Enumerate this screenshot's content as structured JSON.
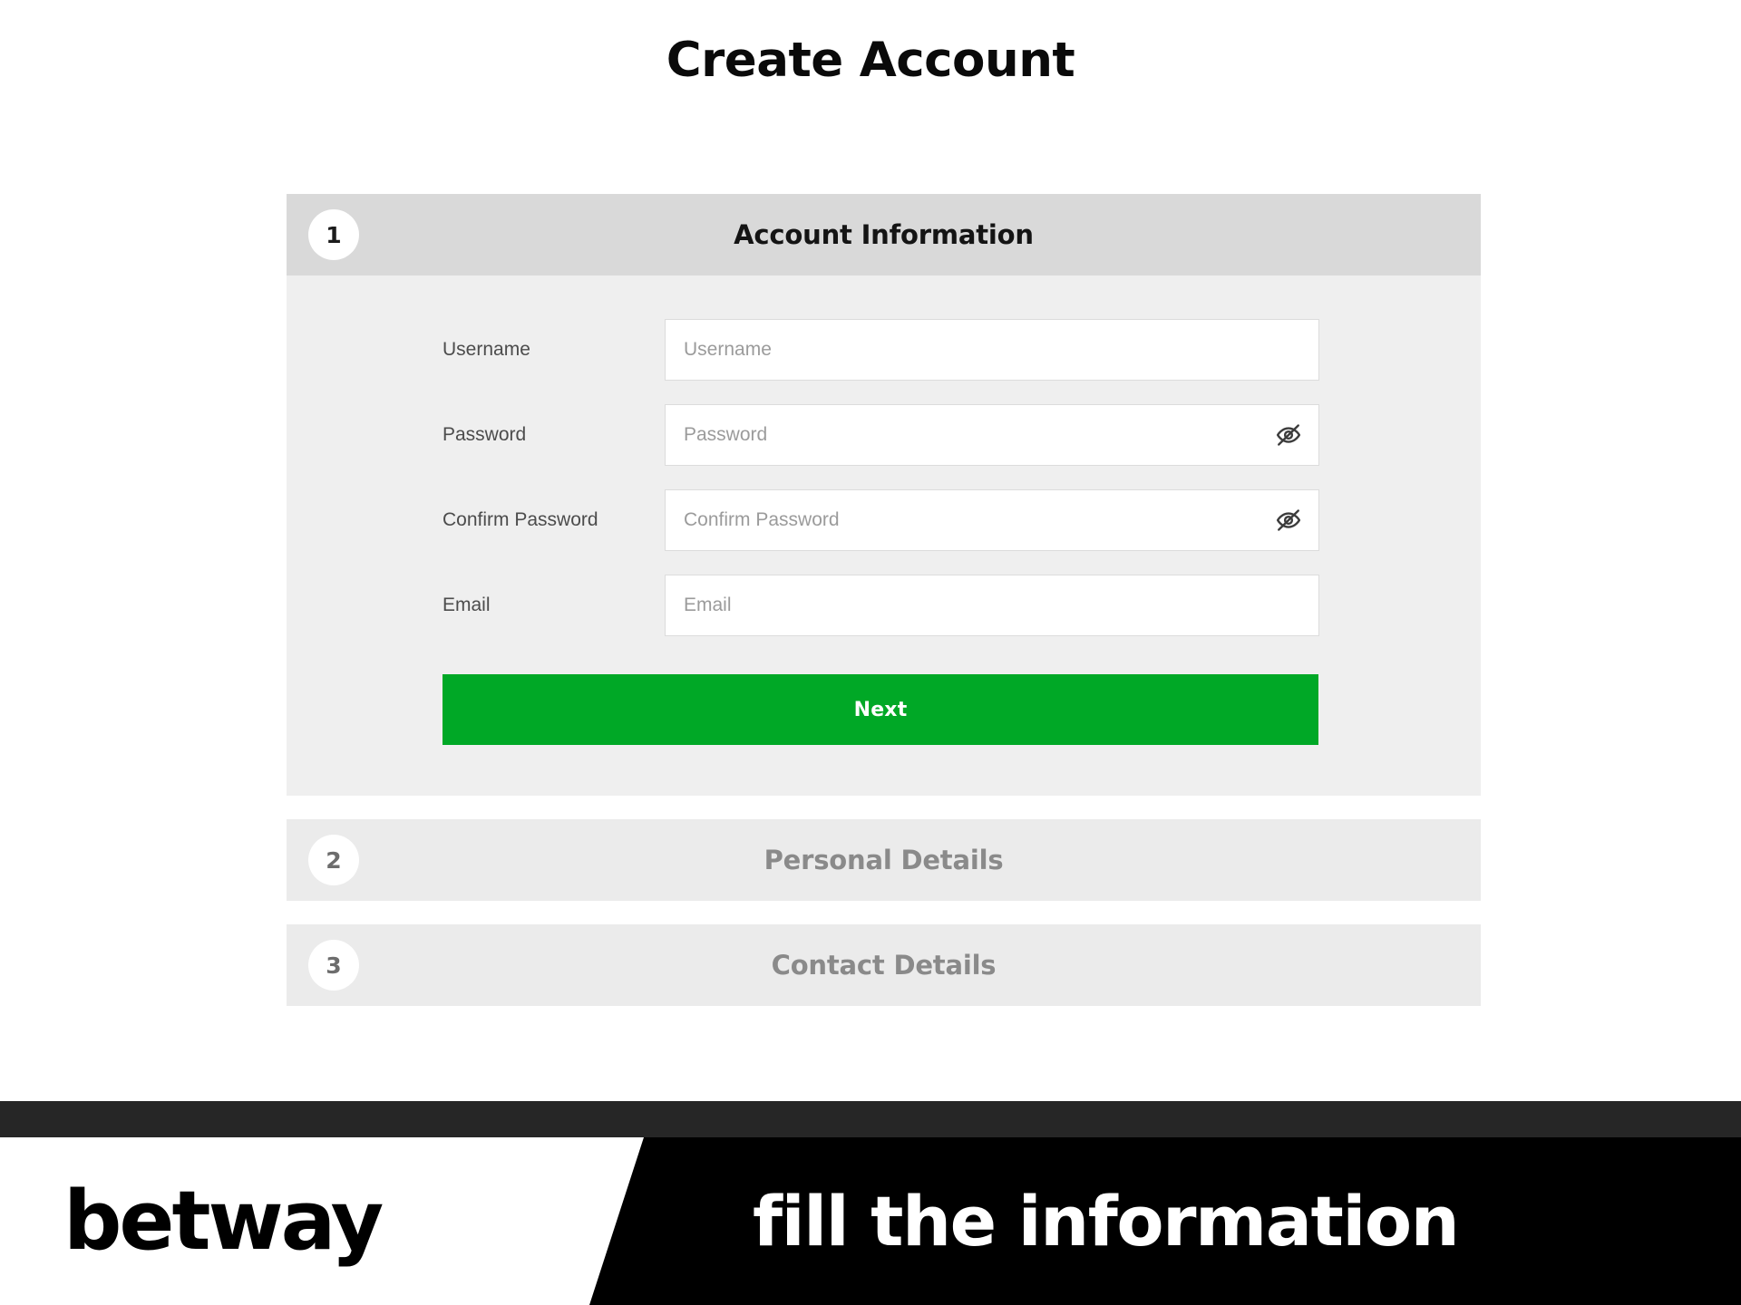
{
  "page": {
    "title": "Create Account"
  },
  "accordion": {
    "steps": [
      {
        "number": "1",
        "title": "Account Information",
        "state": "expanded"
      },
      {
        "number": "2",
        "title": "Personal Details",
        "state": "collapsed"
      },
      {
        "number": "3",
        "title": "Contact Details",
        "state": "collapsed"
      }
    ]
  },
  "form": {
    "fields": [
      {
        "label": "Username",
        "placeholder": "Username",
        "value": "",
        "type": "text",
        "has_toggle": false
      },
      {
        "label": "Password",
        "placeholder": "Password",
        "value": "",
        "type": "password",
        "has_toggle": true,
        "toggle_icon": "eye-off-icon"
      },
      {
        "label": "Confirm Password",
        "placeholder": "Confirm Password",
        "value": "",
        "type": "password",
        "has_toggle": true,
        "toggle_icon": "eye-off-icon"
      },
      {
        "label": "Email",
        "placeholder": "Email",
        "value": "",
        "type": "email",
        "has_toggle": false
      }
    ],
    "submit_label": "Next"
  },
  "banner": {
    "logo": "betway",
    "caption": "fill the information"
  },
  "colors": {
    "accent_green": "#00a826",
    "header_active": "#d9d9d9",
    "header_inactive": "#ebebeb",
    "body_panel": "#efefef",
    "banner_strip": "#262626",
    "banner_black": "#000000"
  }
}
